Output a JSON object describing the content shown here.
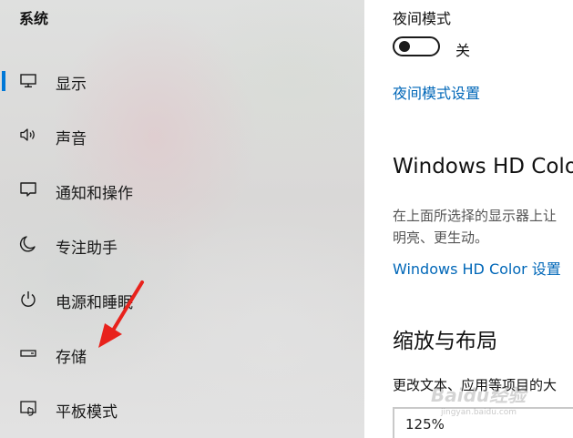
{
  "sidebar": {
    "title": "系统",
    "items": [
      {
        "label": "显示",
        "icon": "monitor-icon",
        "selected": true
      },
      {
        "label": "声音",
        "icon": "speaker-icon",
        "selected": false
      },
      {
        "label": "通知和操作",
        "icon": "notification-icon",
        "selected": false
      },
      {
        "label": "专注助手",
        "icon": "moon-icon",
        "selected": false
      },
      {
        "label": "电源和睡眠",
        "icon": "power-icon",
        "selected": false
      },
      {
        "label": "存储",
        "icon": "storage-drive-icon",
        "selected": false
      },
      {
        "label": "平板模式",
        "icon": "tablet-mode-icon",
        "selected": false
      }
    ],
    "accent_color": "#0078d7"
  },
  "main": {
    "night_light": {
      "heading": "夜间模式",
      "toggle_state_label": "关",
      "settings_link": "夜间模式设置"
    },
    "hdr": {
      "heading": "Windows HD Colo",
      "description_line1": "在上面所选择的显示器上让",
      "description_line2": "明亮、更生动。",
      "settings_link": "Windows HD Color 设置"
    },
    "scale": {
      "heading": "缩放与布局",
      "description": "更改文本、应用等项目的大",
      "dropdown_value": "125%"
    },
    "link_color": "#0067b8"
  },
  "watermark": {
    "text": "Baidu经验",
    "sub": "jingyan.baidu.com"
  },
  "annotation": {
    "arrow_color": "#e8221c"
  }
}
